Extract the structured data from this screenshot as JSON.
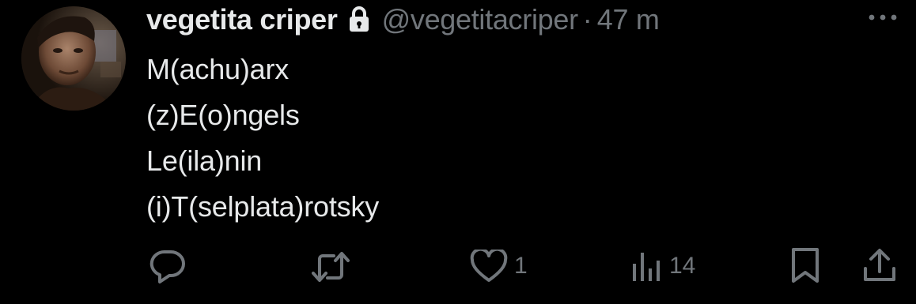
{
  "author": {
    "display_name": "vegetita criper",
    "handle": "@vegetitacriper",
    "separator": "·",
    "time": "47 m",
    "protected_icon": "lock-icon"
  },
  "tweet": {
    "lines": [
      "M(achu)arx",
      "(z)E(o)ngels",
      "Le(ila)nin",
      "(i)T(selplata)rotsky"
    ]
  },
  "actions": {
    "reply": {
      "icon": "reply-icon",
      "count": ""
    },
    "retweet": {
      "icon": "retweet-icon",
      "count": ""
    },
    "like": {
      "icon": "heart-icon",
      "count": "1"
    },
    "views": {
      "icon": "views-icon",
      "count": "14"
    },
    "bookmark": {
      "icon": "bookmark-icon"
    },
    "share": {
      "icon": "share-icon"
    }
  },
  "colors": {
    "background": "#000000",
    "primary_text": "#e7e9ea",
    "secondary_text": "#71767b"
  }
}
